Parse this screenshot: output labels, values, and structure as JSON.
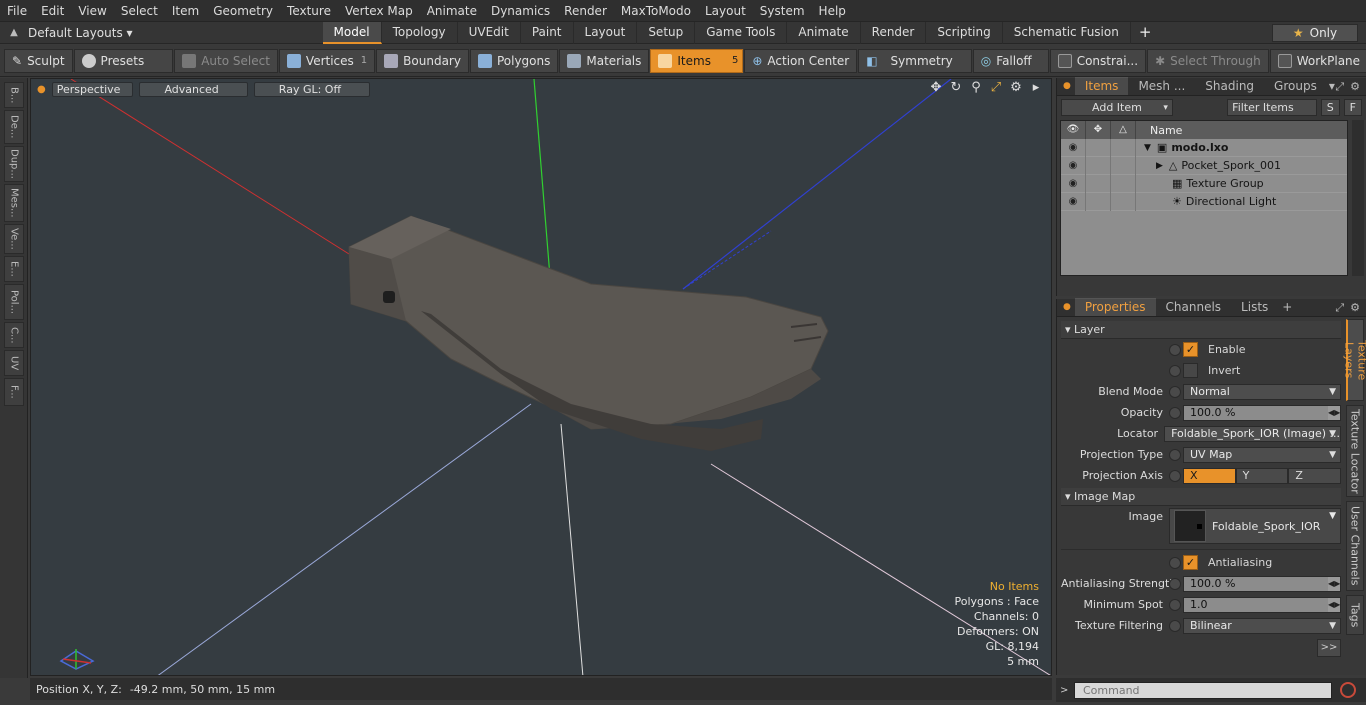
{
  "menu": [
    "File",
    "Edit",
    "View",
    "Select",
    "Item",
    "Geometry",
    "Texture",
    "Vertex Map",
    "Animate",
    "Dynamics",
    "Render",
    "MaxToModo",
    "Layout",
    "System",
    "Help"
  ],
  "layout_select": "Default Layouts ▾",
  "mode_tabs": [
    "Model",
    "Topology",
    "UVEdit",
    "Paint",
    "Layout",
    "Setup",
    "Game Tools",
    "Animate",
    "Render",
    "Scripting",
    "Schematic Fusion"
  ],
  "only_label": "Only",
  "toolbar": {
    "sculpt": "Sculpt",
    "presets": "Presets",
    "auto_select": "Auto Select",
    "vertices": "Vertices",
    "vertices_count": "1",
    "boundary": "Boundary",
    "polygons": "Polygons",
    "materials": "Materials",
    "items": "Items",
    "items_count": "5",
    "action_center": "Action Center",
    "symmetry": "Symmetry",
    "falloff": "Falloff",
    "constraints": "Constrai...",
    "select_through": "Select Through",
    "workplane": "WorkPlane"
  },
  "left_tabs": [
    "B...",
    "De...",
    "Dup...",
    "Mes...",
    "Ve...",
    "E...",
    "Pol...",
    "C...",
    "UV",
    "F..."
  ],
  "viewport": {
    "perspective": "Perspective",
    "advanced": "Advanced",
    "raygl": "Ray GL: Off",
    "info": {
      "no_items": "No Items",
      "polygons": "Polygons : Face",
      "channels": "Channels: 0",
      "deformers": "Deformers: ON",
      "gl": "GL: 8,194",
      "scale": "5 mm"
    }
  },
  "status": {
    "label": "Position X, Y, Z:",
    "value": "-49.2 mm, 50 mm, 15 mm"
  },
  "items_panel": {
    "tabs": [
      "Items",
      "Mesh ...",
      "Shading",
      "Groups"
    ],
    "add_item": "Add Item",
    "filter_items": "Filter Items",
    "s_btn": "S",
    "f_btn": "F",
    "name_header": "Name",
    "rows": [
      {
        "name": "modo.lxo",
        "indent": 0
      },
      {
        "name": "Pocket_Spork_001",
        "indent": 1
      },
      {
        "name": "Texture Group",
        "indent": 1
      },
      {
        "name": "Directional Light",
        "indent": 1
      }
    ]
  },
  "props_panel": {
    "tabs": [
      "Properties",
      "Channels",
      "Lists"
    ],
    "layer_section": "Layer",
    "enable": "Enable",
    "invert": "Invert",
    "blend_mode_label": "Blend Mode",
    "blend_mode_value": "Normal",
    "opacity_label": "Opacity",
    "opacity_value": "100.0 %",
    "locator_label": "Locator",
    "locator_value": "Foldable_Spork_IOR (Image) ...",
    "projection_type_label": "Projection Type",
    "projection_type_value": "UV Map",
    "projection_axis_label": "Projection Axis",
    "axis_x": "X",
    "axis_y": "Y",
    "axis_z": "Z",
    "image_map_section": "Image Map",
    "image_label": "Image",
    "image_value": "Foldable_Spork_IOR",
    "antialiasing": "Antialiasing",
    "aa_strength_label": "Antialiasing Strength",
    "aa_strength_value": "100.0 %",
    "min_spot_label": "Minimum Spot",
    "min_spot_value": "1.0",
    "tex_filter_label": "Texture Filtering",
    "tex_filter_value": "Bilinear",
    "expand": ">>",
    "vtabs": [
      "Texture Layers",
      "Texture Locator",
      "User Channels",
      "Tags"
    ]
  },
  "command": {
    "placeholder": "Command"
  },
  "colors": {
    "accent": "#e8922a",
    "viewport_bg": "#353c41",
    "mesh": "#5a5550"
  }
}
